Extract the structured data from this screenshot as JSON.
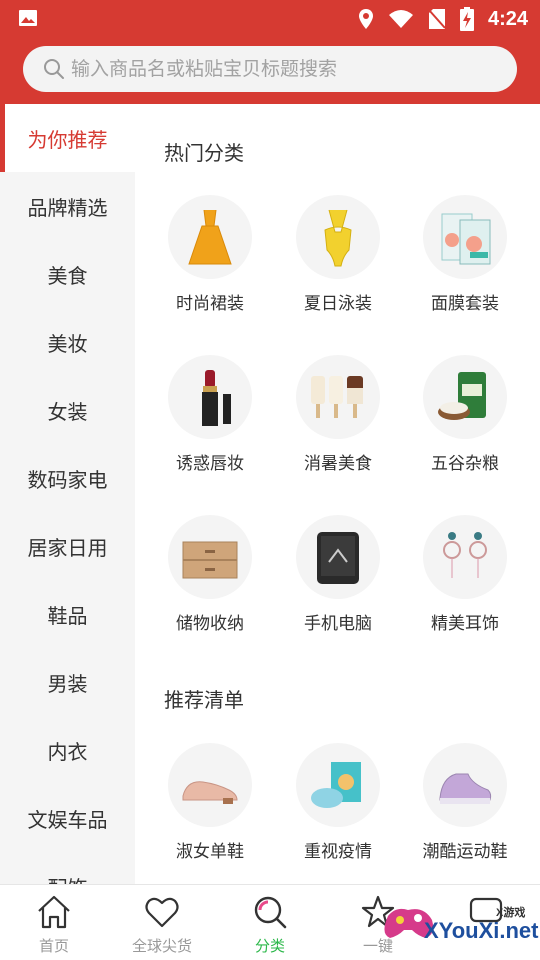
{
  "status_bar": {
    "time": "4:24"
  },
  "search": {
    "placeholder": "输入商品名或粘贴宝贝标题搜索"
  },
  "sidebar": {
    "items": [
      {
        "label": "为你推荐",
        "active": true
      },
      {
        "label": "品牌精选"
      },
      {
        "label": "美食"
      },
      {
        "label": "美妆"
      },
      {
        "label": "女装"
      },
      {
        "label": "数码家电"
      },
      {
        "label": "居家日用"
      },
      {
        "label": "鞋品"
      },
      {
        "label": "男装"
      },
      {
        "label": "内衣"
      },
      {
        "label": "文娱车品"
      },
      {
        "label": "配饰"
      }
    ]
  },
  "main": {
    "hot_title": "热门分类",
    "hot_items": [
      {
        "label": "时尚裙装",
        "icon": "dress-icon"
      },
      {
        "label": "夏日泳装",
        "icon": "swimsuit-icon"
      },
      {
        "label": "面膜套装",
        "icon": "facemask-box-icon"
      },
      {
        "label": "诱惑唇妆",
        "icon": "lipstick-icon"
      },
      {
        "label": "消暑美食",
        "icon": "popsicle-icon"
      },
      {
        "label": "五谷杂粮",
        "icon": "rice-bag-icon"
      },
      {
        "label": "储物收纳",
        "icon": "storage-drawer-icon"
      },
      {
        "label": "手机电脑",
        "icon": "phone-icon"
      },
      {
        "label": "精美耳饰",
        "icon": "earring-icon"
      }
    ],
    "rec_title": "推荐清单",
    "rec_items": [
      {
        "label": "淑女单鞋",
        "icon": "loafer-icon"
      },
      {
        "label": "重视疫情",
        "icon": "face-mask-icon"
      },
      {
        "label": "潮酷运动鞋",
        "icon": "sneaker-icon"
      }
    ]
  },
  "bottom_nav": [
    {
      "label": "首页",
      "icon": "home-icon"
    },
    {
      "label": "全球尖货",
      "icon": "heart-icon"
    },
    {
      "label": "分类",
      "icon": "search-category-icon",
      "active": true
    },
    {
      "label": "一键",
      "icon": "star-icon"
    },
    {
      "label": "",
      "icon": "chat-icon"
    }
  ],
  "watermark": {
    "text": "XYouXi.net",
    "small": "X游戏"
  },
  "colors": {
    "brand": "#d63a32",
    "active_nav": "#2db84b"
  }
}
